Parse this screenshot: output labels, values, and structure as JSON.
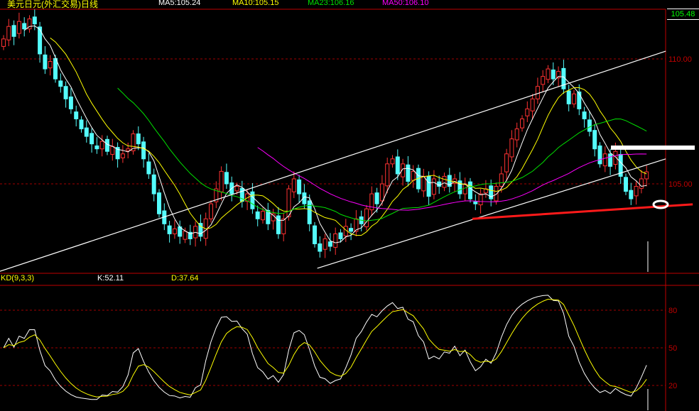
{
  "header": {
    "title": "美元日元(外汇交易)日线",
    "ma5": "MA5:105.24",
    "ma10": "MA10:105.15",
    "ma23": "MA23:106.16",
    "ma50": "MA50:106.10",
    "last_price": "105.48"
  },
  "kd_header": {
    "name": "KD(9,3,3)",
    "k": "K:52.11",
    "d": "D:37.64"
  },
  "colors": {
    "up": "#ff3232",
    "down": "#54fcfc",
    "ma5": "#ffffff",
    "ma10": "#ffff00",
    "ma23": "#00e000",
    "ma50": "#ff00ff",
    "axis": "#c00000"
  },
  "chart_data": [
    {
      "type": "candlestick",
      "title": "美元日元(外汇交易)日线",
      "ylim": [
        101.3,
        111.5
      ],
      "y_ticks": [
        {
          "value": 110,
          "label": "110.00"
        },
        {
          "value": 105,
          "label": "105.00"
        }
      ],
      "close": [
        110.8,
        111.3,
        110.9,
        111.5,
        111.2,
        111.6,
        111.4,
        110.2,
        109.6,
        109.9,
        109.2,
        108.9,
        108.4,
        108.0,
        107.6,
        107.2,
        106.9,
        106.6,
        106.4,
        106.7,
        106.3,
        106.5,
        106.0,
        106.2,
        106.4,
        107.0,
        106.6,
        106.0,
        105.4,
        104.6,
        103.8,
        103.4,
        103.0,
        103.2,
        102.9,
        103.1,
        102.8,
        103.3,
        102.9,
        103.6,
        104.2,
        104.8,
        105.5,
        105.0,
        104.6,
        104.9,
        104.3,
        104.6,
        104.0,
        103.6,
        103.9,
        103.4,
        103.8,
        103.0,
        103.6,
        104.8,
        105.2,
        104.6,
        104.2,
        103.4,
        102.6,
        102.3,
        102.8,
        102.5,
        103.0,
        102.8,
        103.3,
        103.1,
        103.6,
        103.4,
        104.0,
        104.6,
        104.2,
        105.0,
        105.8,
        106.0,
        105.4,
        105.8,
        105.1,
        105.5,
        104.8,
        105.3,
        104.5,
        105.2,
        104.9,
        105.3,
        104.9,
        105.2,
        104.6,
        105.0,
        104.4,
        104.2,
        104.6,
        104.8,
        104.4,
        104.9,
        105.4,
        106.2,
        106.8,
        107.2,
        107.6,
        108.0,
        108.4,
        108.9,
        109.3,
        109.6,
        109.2,
        109.5,
        108.8,
        108.2,
        108.6,
        108.0,
        107.6,
        107.1,
        106.4,
        105.8,
        106.2,
        105.7,
        106.3,
        105.3,
        104.7,
        104.4,
        104.9,
        105.2,
        105.48
      ],
      "moving_averages": [
        5,
        10,
        23,
        50
      ],
      "trendlines": [
        {
          "name": "upper-channel",
          "from": [
            -0.7,
            101.5
          ],
          "to": [
            127.7,
            110.31
          ],
          "color": "#ffffff"
        },
        {
          "name": "lower-channel",
          "from": [
            60.5,
            101.62
          ],
          "to": [
            127.7,
            106.0
          ],
          "color": "#ffffff"
        },
        {
          "name": "support",
          "from": [
            90.4,
            103.6
          ],
          "to": [
            132.9,
            104.18
          ],
          "color": "#ff1a1a"
        }
      ]
    },
    {
      "type": "line",
      "title": "KD(9,3,3)",
      "ylim": [
        0,
        100
      ],
      "y_ticks": [
        {
          "value": 80,
          "label": "80"
        },
        {
          "value": 50,
          "label": "50"
        },
        {
          "value": 20,
          "label": "20"
        }
      ],
      "series": [
        {
          "name": "K",
          "value": 52.11
        },
        {
          "name": "D",
          "value": 37.64
        }
      ]
    }
  ]
}
